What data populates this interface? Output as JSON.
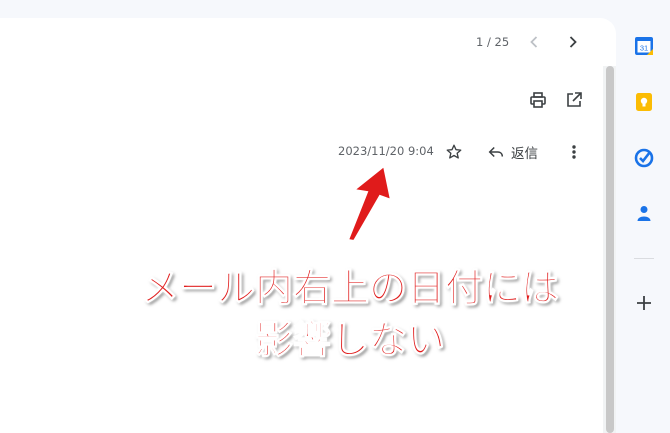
{
  "pager": {
    "text": "1 / 25"
  },
  "toolbar": {
    "prev_icon": "chevron-left",
    "next_icon": "chevron-right",
    "print_icon": "printer",
    "open_new_window_icon": "open-in-new"
  },
  "message": {
    "date": "2023/11/20 9:04",
    "reply_label": "返信"
  },
  "side_panel": {
    "icons": [
      "calendar",
      "keep",
      "tasks",
      "contacts",
      "add"
    ],
    "calendar_day": "31"
  },
  "annotation": {
    "line1": "メール内右上の日付には",
    "line2": "影響しない",
    "color": "#e01b1b"
  }
}
